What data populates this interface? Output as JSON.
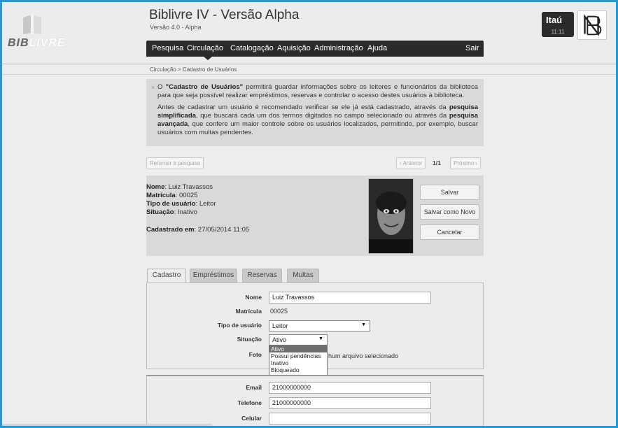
{
  "header": {
    "logo_text_a": "BIB",
    "logo_text_b": "LIVRE",
    "title": "Biblivre IV - Versão Alpha",
    "version": "Versão 4.0 - Alpha",
    "bank": "Itaú",
    "time": "11:11"
  },
  "menu": {
    "items": [
      "Pesquisa",
      "Circulação",
      "Catalogação",
      "Aquisição",
      "Administração",
      "Ajuda"
    ],
    "active": "Circulação",
    "logout": "Sair"
  },
  "breadcrumb": "Circulação > Cadastro de Usuários",
  "info": {
    "close": "×",
    "p1_a": "O ",
    "p1_b": "\"Cadastro de Usuários\"",
    "p1_c": " permitirá guardar informações sobre os leitores e funcionários da biblioteca para que seja possível realizar empréstimos, reservas e controlar o acesso destes usuários à biblioteca.",
    "p2_a": "Antes de cadastrar um usuário é recomendado verificar se ele já está cadastrado, através da ",
    "p2_b": "pesquisa simplificada",
    "p2_c": ", que buscará cada um dos termos digitados no campo selecionado ou através da ",
    "p2_d": "pesquisa avançada",
    "p2_e": ", que confere um maior controle sobre os usuários localizados, permitindo, por exemplo, buscar usuários com multas pendentes."
  },
  "pager": {
    "back": "Retornar à pesquisa",
    "prev": "‹ Anterior",
    "count": "1/1",
    "next": "Próximo ›"
  },
  "user": {
    "name_label": "Nome",
    "name": ": Luiz Travassos",
    "enrollment_label": "Matrícula",
    "enrollment": ": 00025",
    "type_label": "Tipo de usuário",
    "type": ": Leitor",
    "status_label": "Situação",
    "status": ": Inativo",
    "created_label": "Cadastrado em",
    "created": ": 27/05/2014 11:05"
  },
  "actions": {
    "save": "Salvar",
    "save_new": "Salvar como Novo",
    "cancel": "Cancelar"
  },
  "tabs": [
    "Cadastro",
    "Empréstimos",
    "Reservas",
    "Multas"
  ],
  "form": {
    "name_label": "Nome",
    "name_value": "Luiz Travassos",
    "enrollment_label": "Matrícula",
    "enrollment_value": "00025",
    "type_label": "Tipo de usuário",
    "type_value": "Leitor",
    "status_label": "Situação",
    "status_value": "Ativo",
    "photo_label": "Foto",
    "photo_text": "hum arquivo selecionado",
    "status_options": [
      "Ativo",
      "Possui pendências",
      "Inativo",
      "Bloqueado"
    ],
    "status_selected": "Ativo",
    "email_label": "Email",
    "email_value": "21000000000",
    "phone_label": "Telefone",
    "phone_value": "21000000000",
    "mobile_label": "Celular",
    "mobile_value": ""
  },
  "colors": {
    "frame": "#1e9ad6",
    "menubar": "#2b2b2b",
    "panel": "#d9d9d9"
  }
}
